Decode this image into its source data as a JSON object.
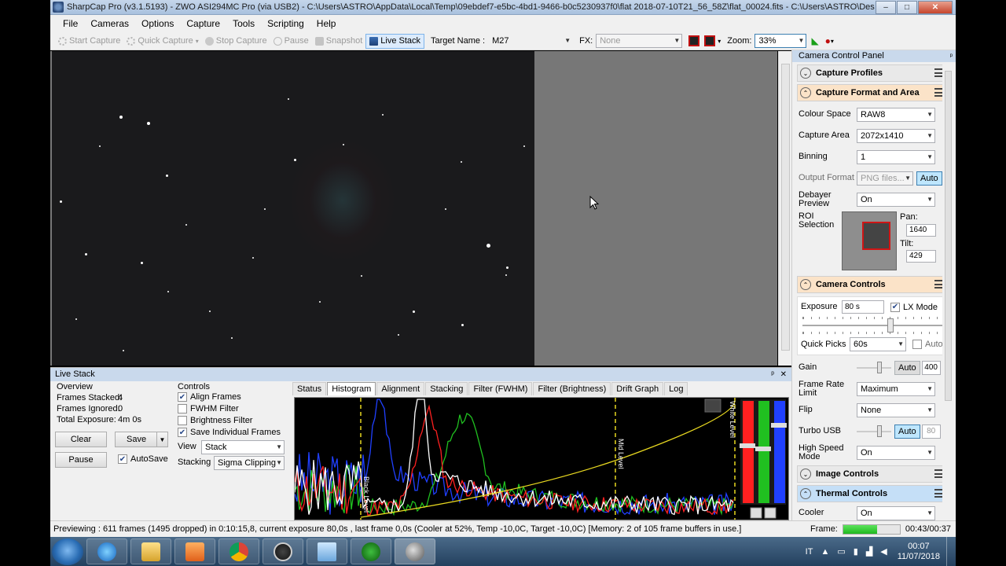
{
  "window": {
    "title": "SharpCap Pro (v3.1.5193) - ZWO ASI294MC Pro (via USB2) - C:\\Users\\ASTRO\\AppData\\Local\\Temp\\09ebdef7-e5bc-4bd1-9466-b0c5230937f0\\flat 2018-07-10T21_56_58Z\\flat_00024.fits - C:\\Users\\ASTRO\\Desktop\\Sh...",
    "minimize": "–",
    "maximize": "□",
    "close": "✕"
  },
  "menu": [
    "File",
    "Cameras",
    "Options",
    "Capture",
    "Tools",
    "Scripting",
    "Help"
  ],
  "toolbar": {
    "start_capture": "Start Capture",
    "quick_capture": "Quick Capture",
    "stop_capture": "Stop Capture",
    "pause": "Pause",
    "snapshot": "Snapshot",
    "live_stack": "Live Stack",
    "target_label": "Target Name :",
    "target_value": "M27",
    "fx_label": "FX:",
    "fx_value": "None",
    "zoom_label": "Zoom:",
    "zoom_value": "33%"
  },
  "control_panel": {
    "title": "Camera Control Panel",
    "sections": {
      "capture_profiles": "Capture Profiles",
      "capture_format": "Capture Format and Area",
      "camera_controls": "Camera Controls",
      "image_controls": "Image Controls",
      "thermal_controls": "Thermal Controls"
    },
    "colour_space_label": "Colour Space",
    "colour_space": "RAW8",
    "capture_area_label": "Capture Area",
    "capture_area": "2072x1410",
    "binning_label": "Binning",
    "binning": "1",
    "output_format_label": "Output Format",
    "output_format": "PNG files...",
    "output_auto": "Auto",
    "debayer_label": "Debayer Preview",
    "debayer": "On",
    "roi_label": "ROI Selection",
    "pan_label": "Pan:",
    "pan": "1640",
    "tilt_label": "Tilt:",
    "tilt": "429",
    "exposure_label": "Exposure",
    "exposure": "80 s",
    "lx_mode": "LX Mode",
    "exposure_level": 0.62,
    "quick_picks_label": "Quick Picks",
    "quick_picks": "60s",
    "quick_picks_auto": "Auto",
    "gain_label": "Gain",
    "gain_auto": "Auto",
    "gain": "400",
    "frame_rate_label": "Frame Rate Limit",
    "frame_rate": "Maximum",
    "flip_label": "Flip",
    "flip": "None",
    "turbo_label": "Turbo USB",
    "turbo_auto": "Auto",
    "turbo": "80",
    "high_speed_label": "High Speed Mode",
    "high_speed": "On",
    "cooler_label": "Cooler",
    "cooler": "On"
  },
  "live_stack": {
    "title": "Live Stack",
    "pin": "ᵖ",
    "close": "✕",
    "overview_label": "Overview",
    "frames_stacked_label": "Frames Stacked:",
    "frames_stacked": "4",
    "frames_ignored_label": "Frames Ignored:",
    "frames_ignored": "0",
    "total_exposure_label": "Total Exposure:",
    "total_exposure": "4m 0s",
    "clear": "Clear",
    "save": "Save",
    "pause": "Pause",
    "autosave": "AutoSave",
    "controls_label": "Controls",
    "align_frames": "Align Frames",
    "fwhm_filter": "FWHM Filter",
    "brightness_filter": "Brightness Filter",
    "save_individual": "Save Individual Frames",
    "view_label": "View",
    "view": "Stack",
    "stacking_label": "Stacking",
    "stacking": "Sigma Clipping",
    "tabs": [
      "Status",
      "Histogram",
      "Alignment",
      "Stacking",
      "Filter (FWHM)",
      "Filter (Brightness)",
      "Drift Graph",
      "Log"
    ],
    "black_level": "Black Level",
    "mid_level": "Mid Level",
    "white_level": "White Level"
  },
  "status": {
    "message": "Previewing : 611 frames (1495 dropped) in 0:10:15,8, current exposure 80,0s , last frame 0,0s  (Cooler at 52%, Temp -10,0C, Target -10,0C) [Memory: 2 of 105 frame buffers in use.]",
    "frame_label": "Frame:",
    "frame_progress": 0.6,
    "elapsed": "00:43/00:37"
  },
  "taskbar": {
    "lang": "IT",
    "time": "00:07",
    "date": "11/07/2018"
  },
  "colors": {
    "panel_header": "#c9d9ec",
    "section_active": "#fbe3c8",
    "section_selected": "#c5dff7",
    "histo_red": "#ff2020",
    "histo_green": "#20c020",
    "histo_blue": "#2040ff",
    "histo_white": "#ffffff",
    "histo_curve": "#e8d820"
  }
}
